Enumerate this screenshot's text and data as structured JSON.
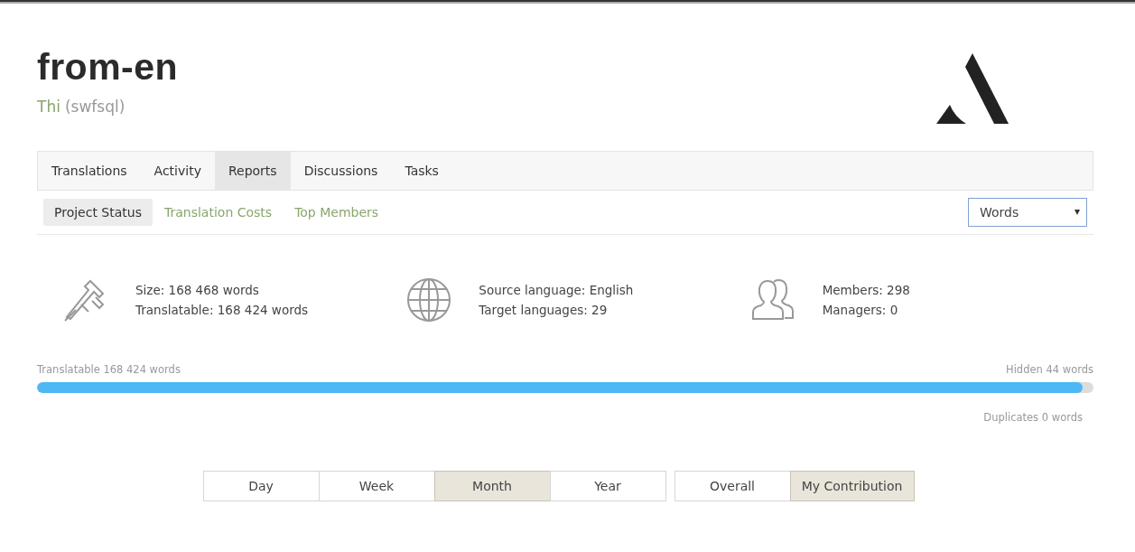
{
  "header": {
    "title": "from-en",
    "owner_name": "Thi",
    "owner_login": "(swfsql)"
  },
  "tabs": [
    {
      "label": "Translations",
      "selected": false
    },
    {
      "label": "Activity",
      "selected": false
    },
    {
      "label": "Reports",
      "selected": true
    },
    {
      "label": "Discussions",
      "selected": false
    },
    {
      "label": "Tasks",
      "selected": false
    }
  ],
  "subtabs": [
    {
      "label": "Project Status",
      "selected": true
    },
    {
      "label": "Translation Costs",
      "selected": false
    },
    {
      "label": "Top Members",
      "selected": false
    }
  ],
  "unit_select": {
    "value": "Words"
  },
  "stats": [
    {
      "kind": "size",
      "lines": [
        "Size: 168 468 words",
        "Translatable: 168 424 words"
      ]
    },
    {
      "kind": "languages",
      "lines": [
        "Source language: English",
        "Target languages: 29"
      ]
    },
    {
      "kind": "members",
      "lines": [
        "Members: 298",
        "Managers: 0"
      ]
    }
  ],
  "progress": {
    "left_label": "Translatable 168 424 words",
    "right_label": "Hidden 44 words",
    "level": 0.99,
    "below_label": "Duplicates 0 words"
  },
  "period_buttons": [
    {
      "label": "Day",
      "selected": false
    },
    {
      "label": "Week",
      "selected": false
    },
    {
      "label": "Month",
      "selected": true
    },
    {
      "label": "Year",
      "selected": false
    }
  ],
  "scope_buttons": [
    {
      "label": "Overall",
      "selected": false
    },
    {
      "label": "My Contribution",
      "selected": true
    }
  ]
}
